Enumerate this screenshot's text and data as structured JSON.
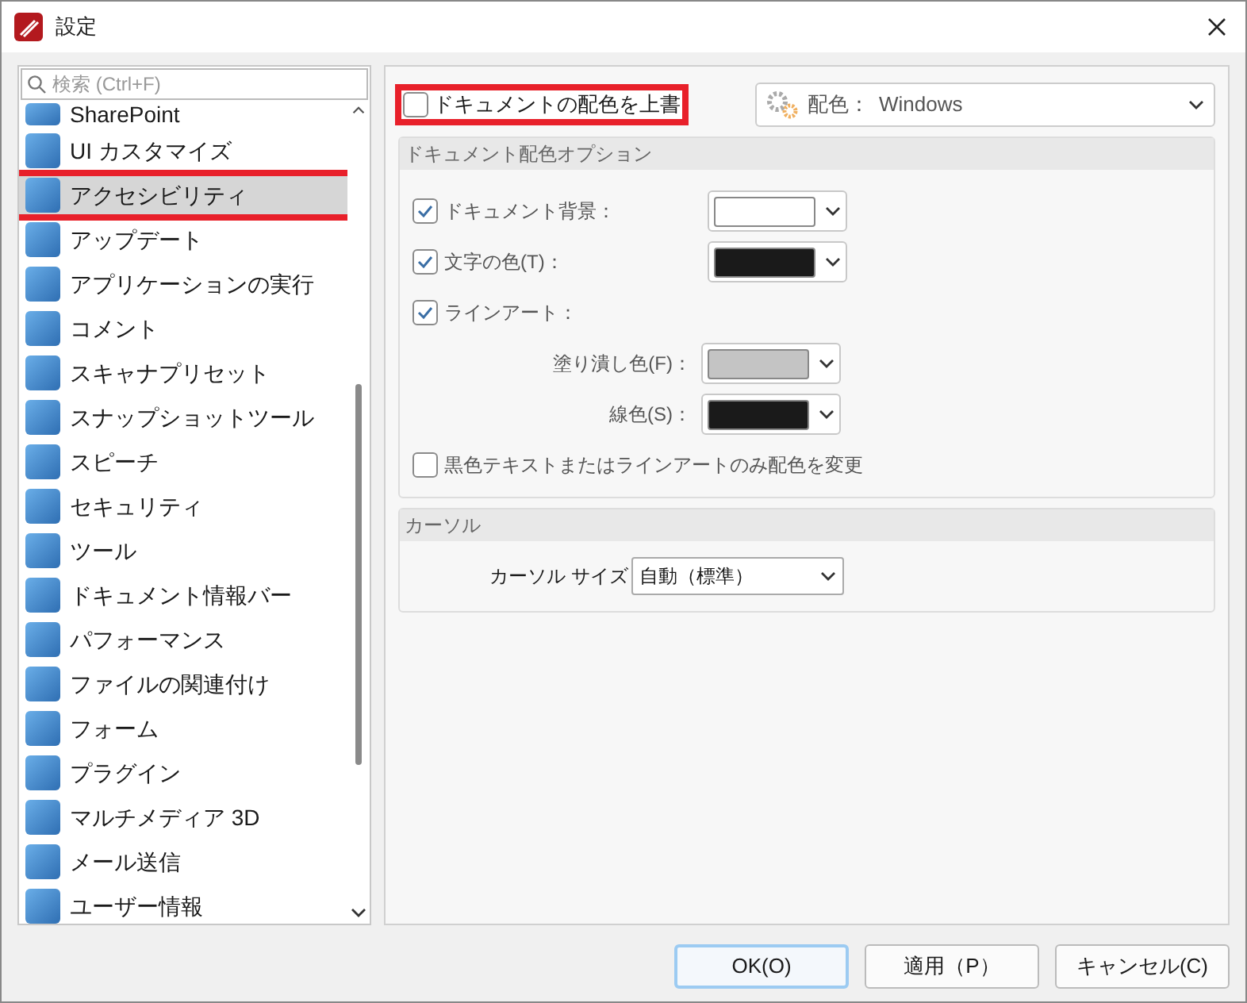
{
  "window": {
    "title": "設定"
  },
  "sidebar": {
    "search": {
      "placeholder": "検索 (Ctrl+F)"
    },
    "items": [
      {
        "label": "SharePoint",
        "selected": false
      },
      {
        "label": "UI カスタマイズ",
        "selected": false
      },
      {
        "label": "アクセシビリティ",
        "selected": true,
        "highlighted": true
      },
      {
        "label": "アップデート",
        "selected": false
      },
      {
        "label": "アプリケーションの実行",
        "selected": false
      },
      {
        "label": "コメント",
        "selected": false
      },
      {
        "label": "スキャナプリセット",
        "selected": false
      },
      {
        "label": "スナップショットツール",
        "selected": false
      },
      {
        "label": "スピーチ",
        "selected": false
      },
      {
        "label": "セキュリティ",
        "selected": false
      },
      {
        "label": "ツール",
        "selected": false
      },
      {
        "label": "ドキュメント情報バー",
        "selected": false
      },
      {
        "label": "パフォーマンス",
        "selected": false
      },
      {
        "label": "ファイルの関連付け",
        "selected": false
      },
      {
        "label": "フォーム",
        "selected": false
      },
      {
        "label": "プラグイン",
        "selected": false
      },
      {
        "label": "マルチメディア 3D",
        "selected": false
      },
      {
        "label": "メール送信",
        "selected": false
      },
      {
        "label": "ユーザー情報",
        "selected": false
      }
    ]
  },
  "override": {
    "label": "ドキュメントの配色を上書",
    "checked": false,
    "highlighted": true
  },
  "scheme": {
    "label": "配色：",
    "value": "Windows"
  },
  "options": {
    "title": "ドキュメント配色オプション",
    "rows": [
      {
        "kind": "check",
        "label": "ドキュメント背景：",
        "checked": true,
        "color": "#ffffff"
      },
      {
        "kind": "check",
        "label": "文字の色(T)：",
        "checked": true,
        "color": "#1a1a1a"
      },
      {
        "kind": "check",
        "label": "ラインアート：",
        "checked": true
      },
      {
        "kind": "indent",
        "label": "塗り潰し色(F)：",
        "color": "#c4c4c4"
      },
      {
        "kind": "indent",
        "label": "線色(S)：",
        "color": "#1a1a1a"
      },
      {
        "kind": "check",
        "label": "黒色テキストまたはラインアートのみ配色を変更",
        "checked": false
      }
    ]
  },
  "cursor": {
    "title": "カーソル",
    "label": "カーソル サイズ",
    "value": "自動（標準）"
  },
  "buttons": [
    {
      "label": "OK(O)",
      "default": true
    },
    {
      "label": "適用（P）",
      "default": false
    },
    {
      "label": "キャンセル(C)",
      "default": false
    }
  ]
}
